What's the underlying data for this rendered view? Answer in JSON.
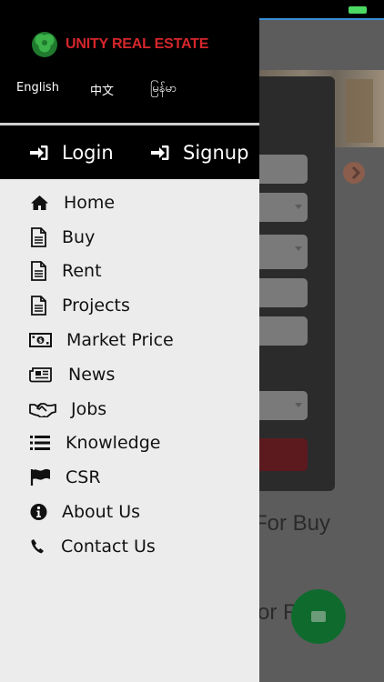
{
  "brand": {
    "name": "UNITY REAL ESTATE",
    "logo_color": "#2e9a3c",
    "text_color": "#d6262b"
  },
  "languages": [
    "English",
    "中文",
    "မြန်မာ"
  ],
  "auth": {
    "login_label": "Login",
    "signup_label": "Signup"
  },
  "menu": [
    {
      "label": "Home",
      "icon": "home-icon"
    },
    {
      "label": "Buy",
      "icon": "document-icon"
    },
    {
      "label": "Rent",
      "icon": "document-icon"
    },
    {
      "label": "Projects",
      "icon": "document-icon"
    },
    {
      "label": "Market Price",
      "icon": "money-icon"
    },
    {
      "label": "News",
      "icon": "newspaper-icon"
    },
    {
      "label": "Jobs",
      "icon": "handshake-icon"
    },
    {
      "label": "Knowledge",
      "icon": "list-icon"
    },
    {
      "label": "CSR",
      "icon": "flag-icon"
    },
    {
      "label": "About Us",
      "icon": "info-icon"
    },
    {
      "label": "Contact Us",
      "icon": "phone-icon"
    }
  ],
  "background": {
    "heading_1": "For Buy",
    "heading_2": "or R"
  },
  "colors": {
    "drawer_bg": "#ececec",
    "drawer_header_bg": "#000000",
    "fab": "#0f6b2d"
  }
}
